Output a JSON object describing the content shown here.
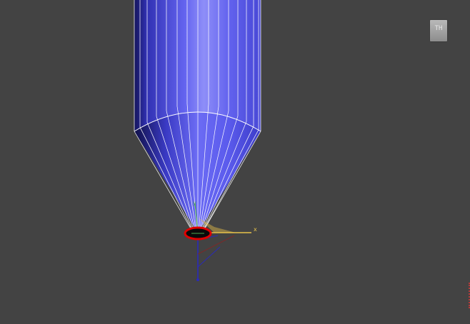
{
  "viewport": {
    "background": "#434343"
  },
  "viewcube": {
    "face_label": "TH",
    "sub_label": "",
    "icon": "viewcube-icon"
  },
  "model": {
    "fill_color": "#5f5ff2",
    "highlight_color": "#8e8ef8",
    "edge_color": "#ffffff"
  },
  "gizmo": {
    "x_label": "x",
    "y_label": "y",
    "x_color": "#e8c24a",
    "y_color": "#4ea84e",
    "z_color": "#2a2ab8",
    "selection_color": "#e00000"
  }
}
